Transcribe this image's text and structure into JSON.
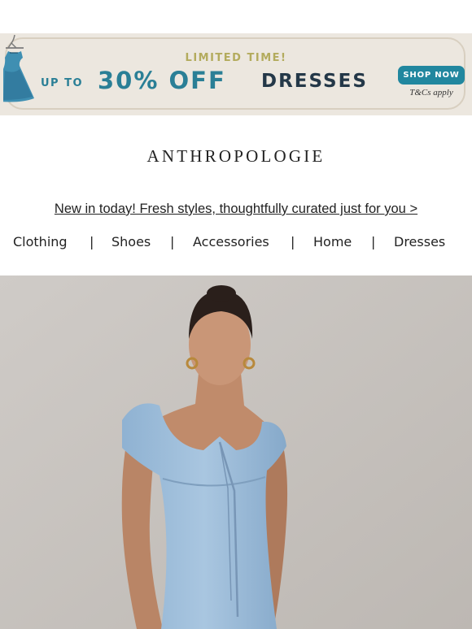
{
  "promo": {
    "eyebrow": "LIMITED TIME!",
    "up_to": "UP TO",
    "amount": "30% OFF",
    "category": "DRESSES",
    "cta_label": "SHOP NOW",
    "terms": "T&Cs apply",
    "icon": "dress-hanger-icon"
  },
  "brand": {
    "logo_text": "ANTHROPOLOGIE"
  },
  "tagline": "New in today! Fresh styles, thoughtfully curated just for you >",
  "nav": {
    "items": [
      "Clothing",
      "Shoes",
      "Accessories",
      "Home",
      "Dresses"
    ],
    "separator": "|"
  },
  "hero": {
    "image": "model in light blue satin maxi dress"
  },
  "colors": {
    "banner_bg": "#ece7df",
    "teal": "#2a7f96",
    "navy": "#243848",
    "mustard": "#b3ab5d",
    "button": "#21879f",
    "hero_bg": "#c9c5c1"
  }
}
